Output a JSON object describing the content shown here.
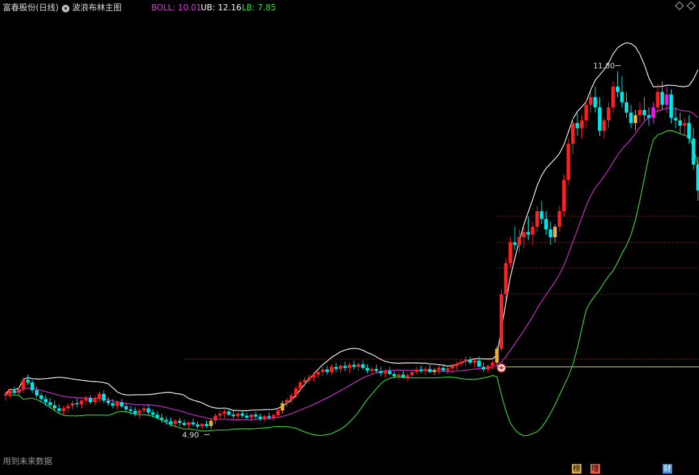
{
  "header": {
    "stock_name": "富春股份(日线)",
    "indicator_name": "波浪布林主图",
    "boll_label": "BOLL: 10.01",
    "ub_label": "UB: 12.16",
    "lb_label": "LB: 7.85"
  },
  "footer": {
    "note": "用到未来数据"
  },
  "tags": [
    {
      "label": "榜",
      "color": "#d4a84a"
    },
    {
      "label": "增",
      "color": "#e0604a"
    },
    {
      "label": "财",
      "color": "#3a8fd8"
    }
  ],
  "colors": {
    "up": "#ff2020",
    "down": "#00e5e5",
    "upper_band": "#ffffff",
    "middle_band": "#d030d0",
    "lower_band": "#33dd33",
    "boll_label": "#d040d0",
    "ub_label": "#ffffff",
    "lb_label": "#33dd33",
    "highlight_gold": "#e8b040",
    "highlight_magenta": "#e020e0",
    "support_line": "#e8e850"
  },
  "chart_data": {
    "type": "candlestick",
    "title": "富春股份(日线)",
    "indicator": "波浪布林主图",
    "ylim": [
      4.4,
      12.8
    ],
    "annotations": [
      {
        "label": "11.80",
        "index": 138,
        "value": 11.8,
        "kind": "high"
      },
      {
        "label": "4.90",
        "index": 46,
        "value": 4.9,
        "kind": "low"
      }
    ],
    "candles": [
      [
        5.55,
        5.62,
        5.45,
        5.58
      ],
      [
        5.58,
        5.68,
        5.5,
        5.64
      ],
      [
        5.64,
        5.72,
        5.55,
        5.6
      ],
      [
        5.6,
        5.7,
        5.52,
        5.67
      ],
      [
        5.67,
        5.9,
        5.6,
        5.85
      ],
      [
        5.85,
        5.95,
        5.75,
        5.8
      ],
      [
        5.8,
        5.85,
        5.6,
        5.65
      ],
      [
        5.65,
        5.72,
        5.5,
        5.55
      ],
      [
        5.55,
        5.6,
        5.42,
        5.48
      ],
      [
        5.48,
        5.55,
        5.35,
        5.42
      ],
      [
        5.42,
        5.5,
        5.3,
        5.36
      ],
      [
        5.36,
        5.45,
        5.25,
        5.3
      ],
      [
        5.3,
        5.38,
        5.2,
        5.25
      ],
      [
        5.25,
        5.35,
        5.15,
        5.3
      ],
      [
        5.3,
        5.4,
        5.22,
        5.35
      ],
      [
        5.35,
        5.45,
        5.28,
        5.4
      ],
      [
        5.4,
        5.5,
        5.32,
        5.38
      ],
      [
        5.38,
        5.48,
        5.3,
        5.45
      ],
      [
        5.45,
        5.55,
        5.35,
        5.5
      ],
      [
        5.5,
        5.56,
        5.38,
        5.42
      ],
      [
        5.42,
        5.55,
        5.35,
        5.5
      ],
      [
        5.5,
        5.62,
        5.42,
        5.58
      ],
      [
        5.58,
        5.65,
        5.4,
        5.45
      ],
      [
        5.45,
        5.52,
        5.35,
        5.4
      ],
      [
        5.4,
        5.48,
        5.3,
        5.35
      ],
      [
        5.35,
        5.45,
        5.28,
        5.42
      ],
      [
        5.42,
        5.48,
        5.3,
        5.34
      ],
      [
        5.34,
        5.4,
        5.22,
        5.28
      ],
      [
        5.28,
        5.35,
        5.18,
        5.25
      ],
      [
        5.25,
        5.32,
        5.15,
        5.2
      ],
      [
        5.2,
        5.3,
        5.1,
        5.26
      ],
      [
        5.26,
        5.35,
        5.2,
        5.3
      ],
      [
        5.3,
        5.38,
        5.18,
        5.22
      ],
      [
        5.22,
        5.28,
        5.12,
        5.18
      ],
      [
        5.18,
        5.25,
        5.08,
        5.12
      ],
      [
        5.12,
        5.2,
        5.02,
        5.08
      ],
      [
        5.08,
        5.15,
        4.98,
        5.05
      ],
      [
        5.05,
        5.12,
        4.95,
        5.0
      ],
      [
        5.0,
        5.1,
        4.92,
        5.06
      ],
      [
        5.06,
        5.12,
        4.96,
        5.02
      ],
      [
        5.02,
        5.08,
        4.95,
        4.98
      ],
      [
        4.98,
        5.05,
        4.92,
        5.03
      ],
      [
        5.03,
        5.1,
        4.95,
        4.99
      ],
      [
        4.99,
        5.05,
        4.9,
        4.95
      ],
      [
        4.95,
        5.02,
        4.9,
        5.0
      ],
      [
        5.0,
        5.06,
        4.92,
        4.96
      ],
      [
        4.96,
        5.1,
        4.9,
        5.06
      ],
      [
        5.06,
        5.2,
        5.0,
        5.16
      ],
      [
        5.16,
        5.25,
        5.1,
        5.2
      ],
      [
        5.2,
        5.28,
        5.12,
        5.24
      ],
      [
        5.24,
        5.3,
        5.15,
        5.18
      ],
      [
        5.18,
        5.25,
        5.1,
        5.15
      ],
      [
        5.15,
        5.22,
        5.08,
        5.2
      ],
      [
        5.2,
        5.26,
        5.12,
        5.16
      ],
      [
        5.16,
        5.22,
        5.08,
        5.12
      ],
      [
        5.12,
        5.2,
        5.05,
        5.18
      ],
      [
        5.18,
        5.24,
        5.1,
        5.14
      ],
      [
        5.14,
        5.2,
        5.06,
        5.1
      ],
      [
        5.1,
        5.18,
        5.04,
        5.15
      ],
      [
        5.15,
        5.22,
        5.08,
        5.12
      ],
      [
        5.12,
        5.2,
        5.06,
        5.17
      ],
      [
        5.17,
        5.3,
        5.12,
        5.26
      ],
      [
        5.26,
        5.45,
        5.2,
        5.4
      ],
      [
        5.4,
        5.5,
        5.32,
        5.46
      ],
      [
        5.46,
        5.6,
        5.4,
        5.55
      ],
      [
        5.55,
        5.72,
        5.5,
        5.68
      ],
      [
        5.68,
        5.85,
        5.62,
        5.8
      ],
      [
        5.8,
        5.9,
        5.72,
        5.85
      ],
      [
        5.85,
        5.95,
        5.78,
        5.9
      ],
      [
        5.9,
        6.0,
        5.82,
        5.95
      ],
      [
        5.95,
        6.05,
        5.88,
        6.0
      ],
      [
        6.0,
        6.1,
        5.92,
        6.05
      ],
      [
        6.05,
        6.12,
        5.95,
        6.0
      ],
      [
        6.0,
        6.15,
        5.95,
        6.1
      ],
      [
        6.1,
        6.18,
        6.0,
        6.06
      ],
      [
        6.06,
        6.15,
        5.98,
        6.12
      ],
      [
        6.12,
        6.2,
        6.02,
        6.08
      ],
      [
        6.08,
        6.18,
        5.98,
        6.14
      ],
      [
        6.14,
        6.22,
        6.05,
        6.1
      ],
      [
        6.1,
        6.18,
        6.02,
        6.15
      ],
      [
        6.15,
        6.22,
        6.05,
        6.08
      ],
      [
        6.08,
        6.15,
        5.98,
        6.03
      ],
      [
        6.03,
        6.1,
        5.95,
        6.06
      ],
      [
        6.06,
        6.14,
        5.98,
        6.02
      ],
      [
        6.02,
        6.1,
        5.92,
        5.98
      ],
      [
        5.98,
        6.05,
        5.9,
        6.02
      ],
      [
        6.02,
        6.1,
        5.95,
        5.96
      ],
      [
        5.96,
        6.02,
        5.88,
        5.92
      ],
      [
        5.92,
        6.0,
        5.85,
        5.95
      ],
      [
        5.95,
        6.02,
        5.88,
        5.9
      ],
      [
        5.9,
        5.98,
        5.82,
        5.94
      ],
      [
        5.94,
        6.05,
        5.88,
        6.0
      ],
      [
        6.0,
        6.1,
        5.95,
        6.05
      ],
      [
        6.05,
        6.12,
        5.98,
        6.02
      ],
      [
        6.02,
        6.1,
        5.95,
        6.06
      ],
      [
        6.06,
        6.14,
        5.98,
        6.0
      ],
      [
        6.0,
        6.08,
        5.94,
        6.04
      ],
      [
        6.04,
        6.12,
        5.96,
        6.08
      ],
      [
        6.08,
        6.15,
        6.0,
        6.03
      ],
      [
        6.03,
        6.1,
        5.96,
        6.07
      ],
      [
        6.07,
        6.16,
        6.0,
        6.12
      ],
      [
        6.12,
        6.2,
        6.05,
        6.16
      ],
      [
        6.16,
        6.25,
        6.1,
        6.2
      ],
      [
        6.2,
        6.3,
        6.12,
        6.24
      ],
      [
        6.24,
        6.3,
        6.15,
        6.18
      ],
      [
        6.18,
        6.26,
        6.1,
        6.22
      ],
      [
        6.22,
        6.3,
        6.15,
        6.1
      ],
      [
        6.1,
        6.18,
        6.0,
        6.05
      ],
      [
        6.05,
        6.14,
        5.98,
        6.12
      ],
      [
        6.12,
        6.22,
        6.05,
        6.18
      ],
      [
        6.18,
        6.5,
        6.12,
        6.45
      ],
      [
        6.45,
        7.6,
        6.4,
        7.5
      ],
      [
        7.5,
        8.2,
        7.4,
        8.1
      ],
      [
        8.1,
        8.6,
        8.0,
        8.5
      ],
      [
        8.5,
        8.8,
        8.35,
        8.45
      ],
      [
        8.45,
        8.75,
        8.3,
        8.6
      ],
      [
        8.6,
        8.8,
        8.4,
        8.7
      ],
      [
        8.7,
        9.0,
        8.55,
        8.65
      ],
      [
        8.65,
        8.9,
        8.45,
        8.8
      ],
      [
        8.8,
        9.2,
        8.7,
        9.1
      ],
      [
        9.1,
        9.3,
        8.85,
        8.95
      ],
      [
        8.95,
        9.1,
        8.65,
        8.75
      ],
      [
        8.75,
        8.9,
        8.45,
        8.6
      ],
      [
        8.6,
        8.85,
        8.5,
        8.8
      ],
      [
        8.8,
        9.2,
        8.7,
        9.1
      ],
      [
        9.1,
        9.8,
        9.0,
        9.7
      ],
      [
        9.7,
        10.5,
        9.6,
        10.4
      ],
      [
        10.4,
        10.9,
        10.2,
        10.8
      ],
      [
        10.8,
        11.0,
        10.55,
        10.7
      ],
      [
        10.7,
        10.95,
        10.5,
        10.85
      ],
      [
        10.85,
        11.25,
        10.7,
        11.15
      ],
      [
        11.15,
        11.4,
        11.0,
        11.3
      ],
      [
        11.3,
        11.5,
        11.0,
        11.1
      ],
      [
        11.1,
        11.3,
        10.55,
        10.65
      ],
      [
        10.65,
        10.9,
        10.5,
        10.85
      ],
      [
        10.85,
        11.2,
        10.7,
        11.1
      ],
      [
        11.1,
        11.6,
        11.0,
        11.5
      ],
      [
        11.5,
        11.8,
        11.3,
        11.4
      ],
      [
        11.4,
        11.7,
        11.1,
        11.2
      ],
      [
        11.2,
        11.4,
        10.9,
        11.0
      ],
      [
        11.0,
        11.15,
        10.7,
        10.8
      ],
      [
        10.8,
        11.05,
        10.65,
        10.95
      ],
      [
        10.95,
        11.2,
        10.8,
        11.05
      ],
      [
        11.05,
        11.3,
        10.85,
        10.95
      ],
      [
        10.95,
        11.1,
        10.75,
        10.9
      ],
      [
        10.9,
        11.2,
        10.8,
        11.1
      ],
      [
        11.1,
        11.55,
        11.0,
        11.4
      ],
      [
        11.4,
        11.6,
        11.05,
        11.15
      ],
      [
        11.15,
        11.5,
        11.0,
        11.35
      ],
      [
        11.35,
        11.45,
        10.8,
        10.9
      ],
      [
        10.9,
        11.1,
        10.7,
        10.85
      ],
      [
        10.85,
        11.0,
        10.6,
        10.75
      ],
      [
        10.75,
        10.9,
        10.55,
        10.8
      ],
      [
        10.8,
        10.95,
        10.4,
        10.5
      ],
      [
        10.5,
        10.7,
        9.9,
        10.0
      ],
      [
        10.0,
        10.15,
        9.3,
        9.5
      ]
    ],
    "highlight_days": [
      {
        "index": 46,
        "color": "gold"
      },
      {
        "index": 62,
        "color": "gold"
      },
      {
        "index": 96,
        "color": "gold"
      },
      {
        "index": 110,
        "color": "gold"
      },
      {
        "index": 123,
        "color": "gold"
      },
      {
        "index": 141,
        "color": "gold"
      },
      {
        "index": 145,
        "color": "magenta"
      },
      {
        "index": 148,
        "color": "magenta"
      }
    ]
  }
}
